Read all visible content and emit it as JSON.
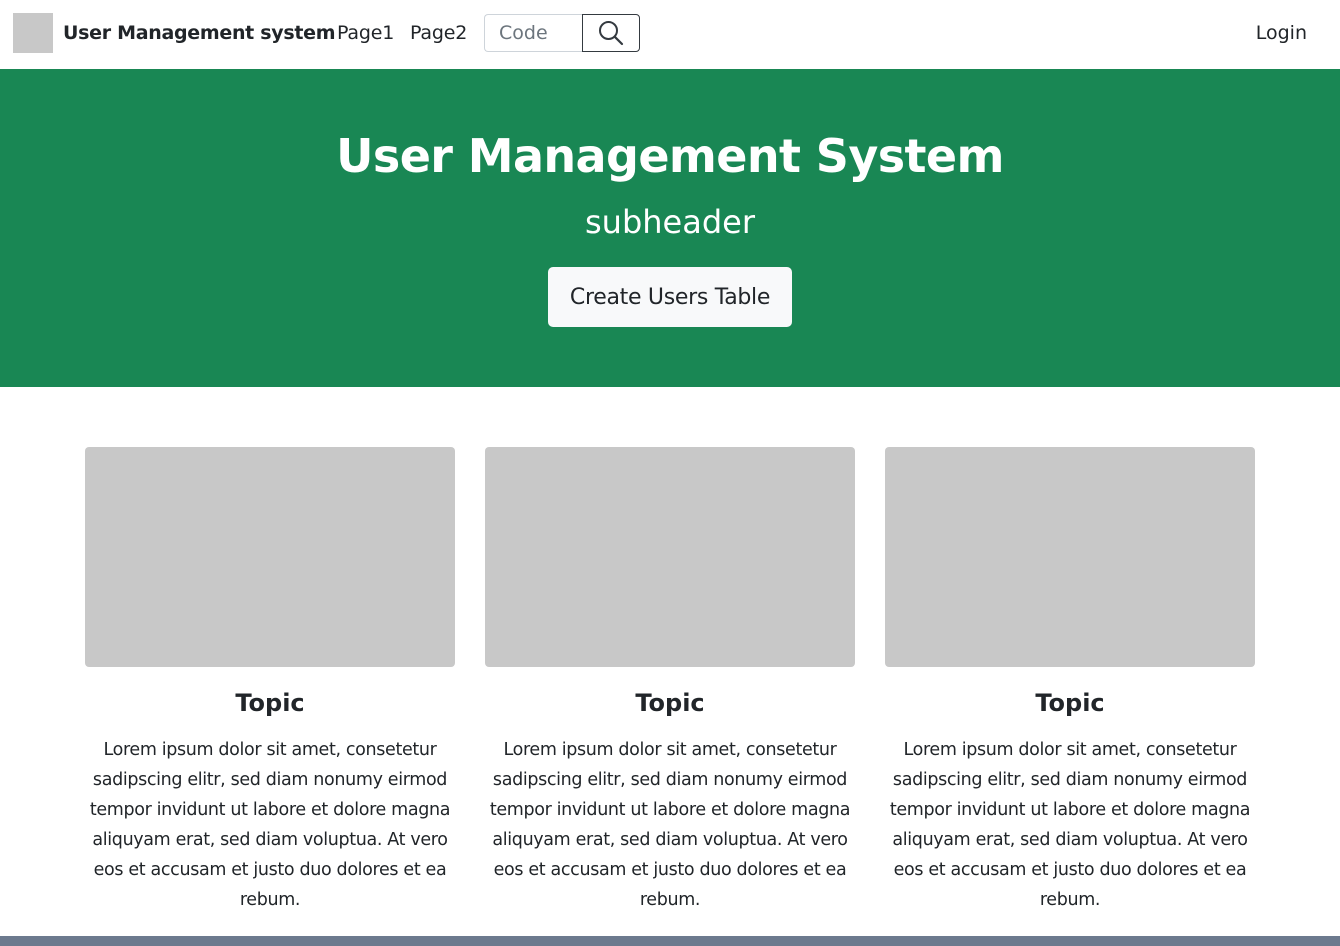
{
  "navbar": {
    "brand": "User Management system",
    "links": [
      {
        "label": "Page1"
      },
      {
        "label": "Page2"
      }
    ],
    "search": {
      "placeholder": "Code",
      "value": ""
    },
    "login_label": "Login"
  },
  "hero": {
    "title": "User Management System",
    "subtitle": "subheader",
    "button_label": "Create Users Table",
    "background_color": "#198754"
  },
  "cards": [
    {
      "title": "Topic",
      "text": "Lorem ipsum dolor sit amet, consetetur sadipscing elitr, sed diam nonumy eirmod tempor invidunt ut labore et dolore magna aliquyam erat, sed diam voluptua. At vero eos et accusam et justo duo dolores et ea rebum."
    },
    {
      "title": "Topic",
      "text": "Lorem ipsum dolor sit amet, consetetur sadipscing elitr, sed diam nonumy eirmod tempor invidunt ut labore et dolore magna aliquyam erat, sed diam voluptua. At vero eos et accusam et justo duo dolores et ea rebum."
    },
    {
      "title": "Topic",
      "text": "Lorem ipsum dolor sit amet, consetetur sadipscing elitr, sed diam nonumy eirmod tempor invidunt ut labore et dolore magna aliquyam erat, sed diam voluptua. At vero eos et accusam et justo duo dolores et ea rebum."
    }
  ],
  "icons": {
    "search": "search-icon",
    "logo": "logo-placeholder"
  }
}
